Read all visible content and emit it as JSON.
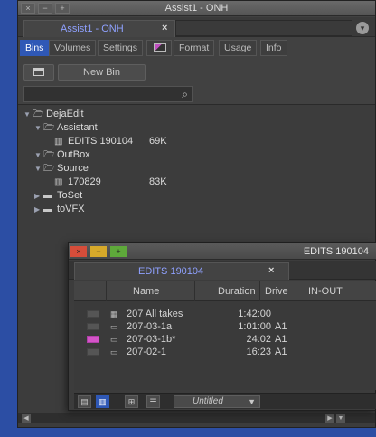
{
  "window_main": {
    "title": "Assist1 - ONH",
    "controls": [
      "×",
      "−",
      "+"
    ],
    "tab_label": "Assist1 - ONH",
    "tab_close": "×",
    "menu_icon": "▾"
  },
  "function_tabs": [
    {
      "label": "Bins",
      "active": true
    },
    {
      "label": "Volumes",
      "active": false
    },
    {
      "label": "Settings",
      "active": false
    },
    {
      "label": "",
      "active": false
    },
    {
      "label": "Format",
      "active": false
    },
    {
      "label": "Usage",
      "active": false
    },
    {
      "label": "Info",
      "active": false
    }
  ],
  "toolbar": {
    "new_bin_label": "New Bin"
  },
  "search": {
    "value": "",
    "placeholder": ""
  },
  "tree": [
    {
      "label": "DejaEdit",
      "depth": 0,
      "expanded": true,
      "type": "folder",
      "size": ""
    },
    {
      "label": "Assistant",
      "depth": 1,
      "expanded": true,
      "type": "folder",
      "size": ""
    },
    {
      "label": "EDITS 190104",
      "depth": 2,
      "expanded": null,
      "type": "bin",
      "size": "69K"
    },
    {
      "label": "OutBox",
      "depth": 1,
      "expanded": true,
      "type": "folder",
      "size": ""
    },
    {
      "label": "Source",
      "depth": 1,
      "expanded": true,
      "type": "folder",
      "size": ""
    },
    {
      "label": "170829",
      "depth": 2,
      "expanded": null,
      "type": "bin",
      "size": "83K"
    },
    {
      "label": "ToSet",
      "depth": 1,
      "expanded": false,
      "type": "folder-closed",
      "size": ""
    },
    {
      "label": "toVFX",
      "depth": 1,
      "expanded": false,
      "type": "folder-closed",
      "size": ""
    }
  ],
  "window_bin": {
    "title": "EDITS 190104",
    "controls": [
      "×",
      "−",
      "+"
    ],
    "tab_label": "EDITS 190104",
    "tab_close": "×",
    "columns": [
      "Name",
      "Duration",
      "Drive",
      "IN-OUT"
    ],
    "clips": [
      {
        "name": "207 All takes",
        "duration": "1:42:00",
        "drive": "",
        "color": "",
        "type": "sequence"
      },
      {
        "name": "207-03-1a",
        "duration": "1:01:00",
        "drive": "A1",
        "color": "",
        "type": "clip"
      },
      {
        "name": "207-03-1b*",
        "duration": "24:02",
        "drive": "A1",
        "color": "#d454c8",
        "type": "clip"
      },
      {
        "name": "207-02-1",
        "duration": "16:23",
        "drive": "A1",
        "color": "",
        "type": "clip"
      }
    ],
    "view_name": "Untitled"
  }
}
